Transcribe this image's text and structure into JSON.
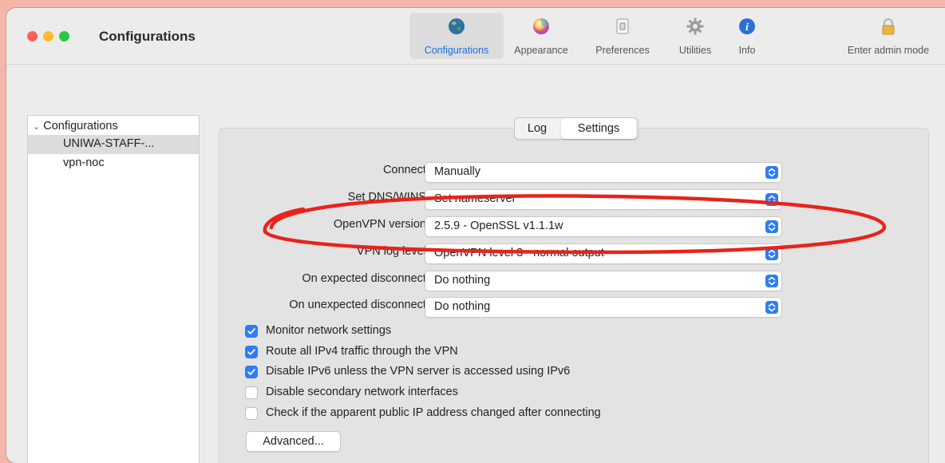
{
  "window": {
    "title": "Configurations"
  },
  "toolbar": {
    "items": [
      {
        "label": "Configurations",
        "icon": "globe-icon"
      },
      {
        "label": "Appearance",
        "icon": "color-wheel-icon"
      },
      {
        "label": "Preferences",
        "icon": "switch-icon"
      },
      {
        "label": "Utilities",
        "icon": "gear-icon"
      },
      {
        "label": "Info",
        "icon": "info-icon"
      }
    ],
    "admin": {
      "label": "Enter admin mode",
      "icon": "lock-icon"
    }
  },
  "sidebar": {
    "header": "Configurations",
    "items": [
      {
        "label": "UNIWA-STAFF-..."
      },
      {
        "label": "vpn-noc"
      }
    ]
  },
  "tabs": {
    "log": "Log",
    "settings": "Settings"
  },
  "settings": {
    "connect": {
      "label": "Connect:",
      "value": "Manually"
    },
    "dns": {
      "label": "Set DNS/WINS:",
      "value": "Set nameserver"
    },
    "openvpn": {
      "label": "OpenVPN version:",
      "value": "2.5.9 - OpenSSL v1.1.1w"
    },
    "loglevel": {
      "label": "VPN log level:",
      "value": "OpenVPN level 3 - normal output"
    },
    "expected": {
      "label": "On expected disconnect:",
      "value": "Do nothing"
    },
    "unexpected": {
      "label": "On unexpected disconnect:",
      "value": "Do nothing"
    }
  },
  "checkboxes": [
    {
      "label": "Monitor network settings",
      "checked": true
    },
    {
      "label": "Route all IPv4 traffic through the VPN",
      "checked": true
    },
    {
      "label": "Disable IPv6 unless the VPN server is accessed using IPv6",
      "checked": true
    },
    {
      "label": "Disable secondary network interfaces",
      "checked": false
    },
    {
      "label": "Check if the apparent public IP address changed after connecting",
      "checked": false
    }
  ],
  "advanced_label": "Advanced...",
  "colors": {
    "accent": "#2d7cf6",
    "annotation": "#e8231a",
    "background": "#f4b6a8"
  }
}
